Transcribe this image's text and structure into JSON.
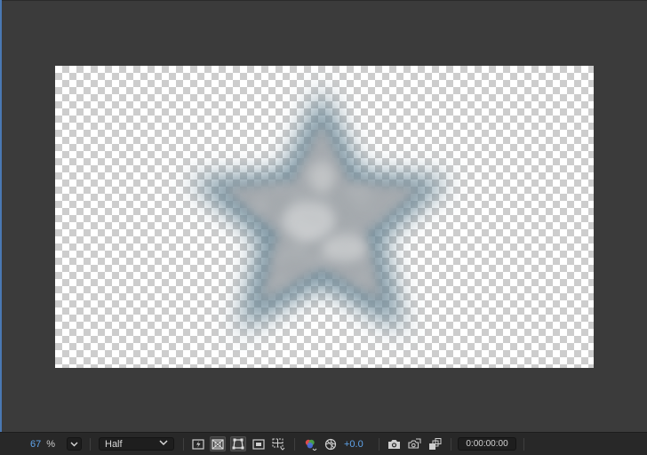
{
  "toolbar": {
    "zoom_value": "67",
    "zoom_unit": "%",
    "resolution": "Half",
    "exposure": "+0.0",
    "timecode": "0:00:00:00"
  },
  "icons": {
    "zoom_menu": "chevron-down-icon",
    "resolution_menu": "chevron-down-icon",
    "fast_previews": "fast-previews-icon",
    "transparency_grid": "transparency-grid-icon",
    "mask_visibility": "mask-path-visibility-icon",
    "region_of_interest": "region-of-interest-icon",
    "guides": "grid-guides-icon",
    "channel": "color-channel-icon",
    "reset_exposure": "reset-exposure-icon",
    "snapshot": "camera-snapshot-icon",
    "show_snapshot": "show-snapshot-icon",
    "views": "views-icon"
  },
  "colors": {
    "accent_blue": "#5fa3ea",
    "panel_bg": "#3b3b3b",
    "toolbar_bg": "#282828"
  }
}
